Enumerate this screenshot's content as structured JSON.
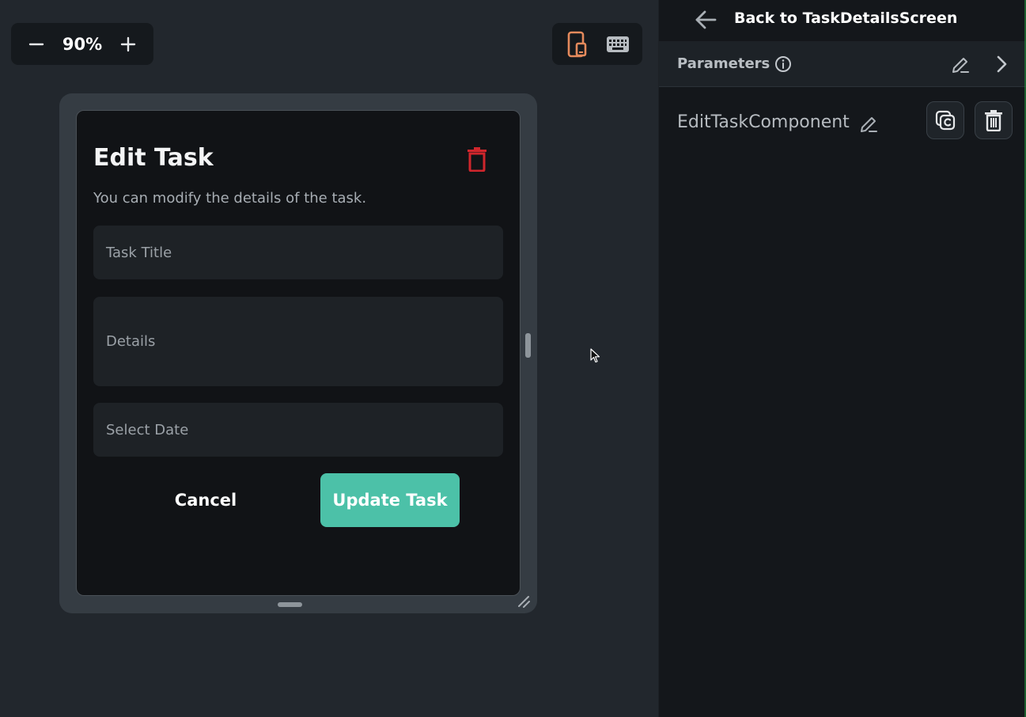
{
  "zoom": {
    "decrease_icon": "minus-icon",
    "value": "90%",
    "increase_icon": "plus-icon"
  },
  "device_toggle": {
    "phone_icon": "phone-tablet-icon",
    "keyboard_icon": "keyboard-icon",
    "active": "phone",
    "active_color": "#e58a5c"
  },
  "dialog": {
    "title": "Edit Task",
    "subtitle": "You can modify the details of the task.",
    "delete_icon": "trash-icon",
    "delete_color": "#d0262c",
    "fields": {
      "title_placeholder": "Task Title",
      "details_placeholder": "Details",
      "date_placeholder": "Select Date"
    },
    "cancel_label": "Cancel",
    "update_label": "Update Task",
    "accent": "#4cc1a8"
  },
  "panel": {
    "back_label": "Back to TaskDetailsScreen",
    "parameters_label": "Parameters",
    "component_name": "EditTaskComponent"
  }
}
